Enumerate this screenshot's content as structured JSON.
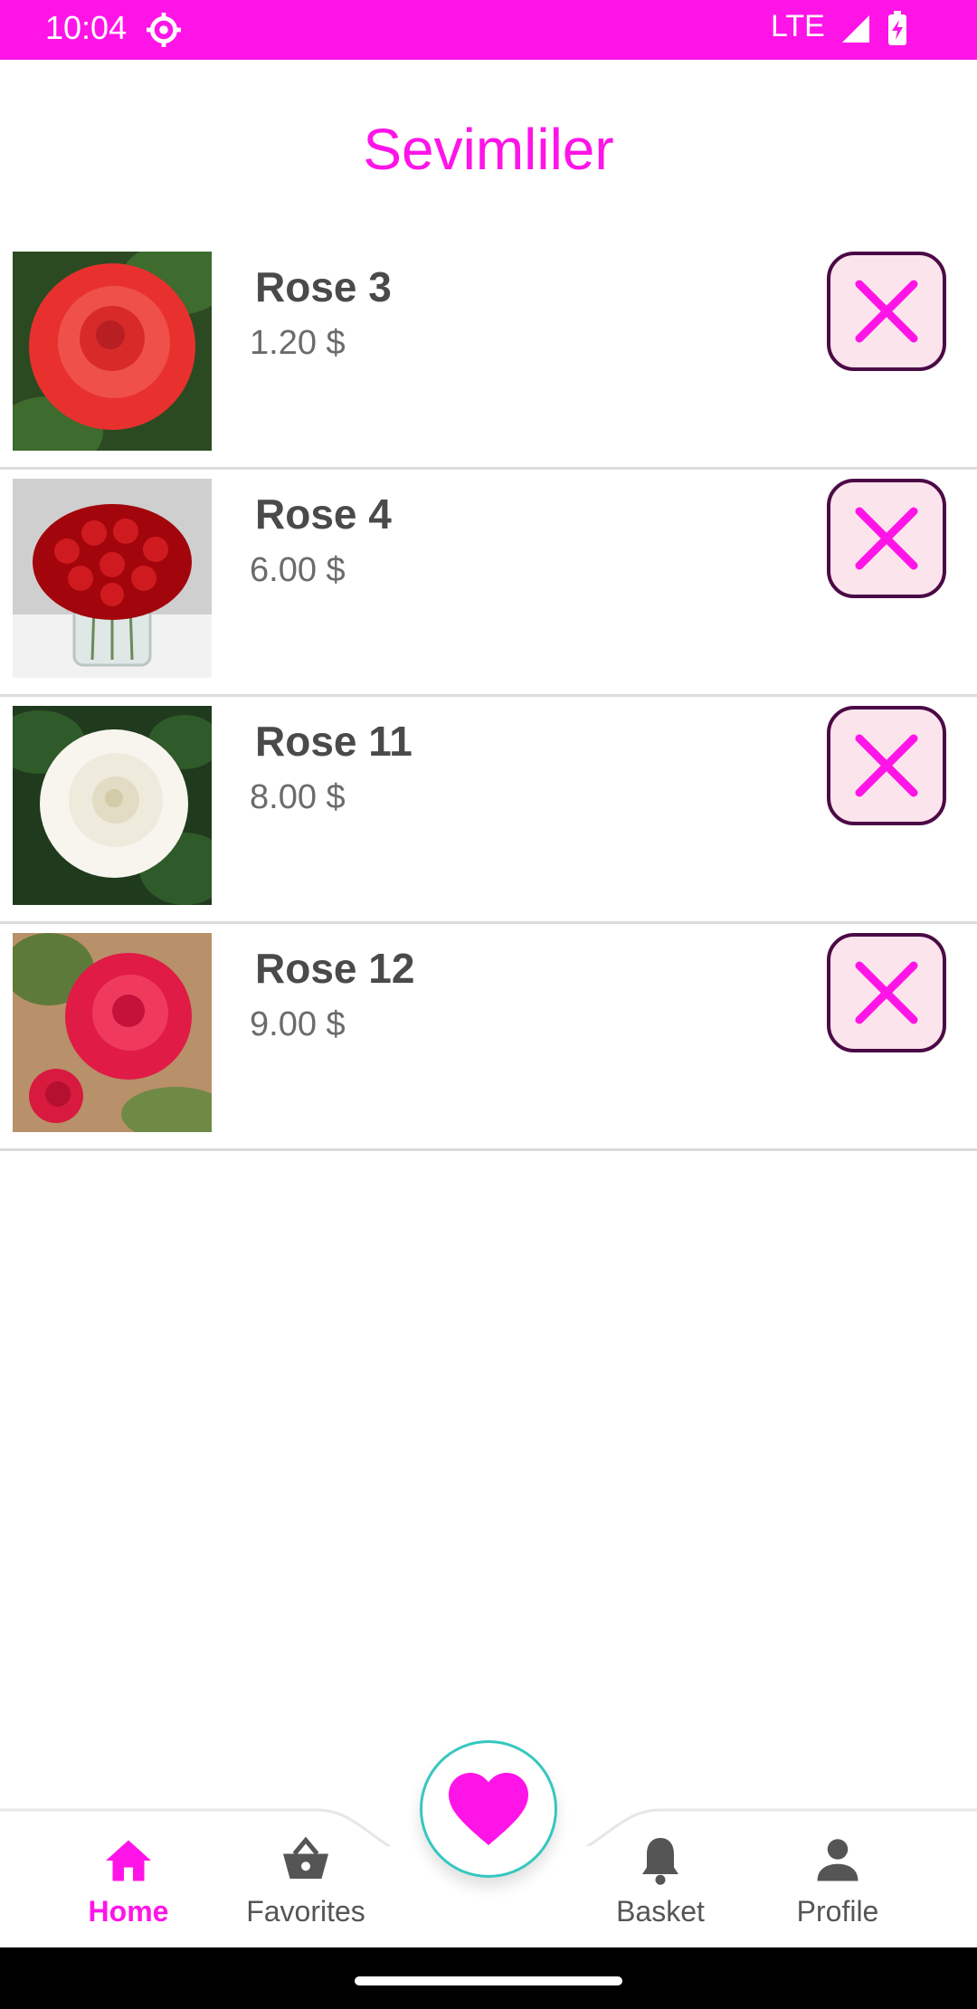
{
  "status_bar": {
    "time": "10:04",
    "network": "LTE"
  },
  "page": {
    "title": "Sevimliler"
  },
  "items": [
    {
      "name": "Rose 3",
      "price": "1.20 $"
    },
    {
      "name": "Rose 4",
      "price": "6.00 $"
    },
    {
      "name": "Rose 11",
      "price": "8.00 $"
    },
    {
      "name": "Rose 12",
      "price": "9.00 $"
    }
  ],
  "bottom_nav": {
    "items": [
      {
        "label": "Home",
        "icon": "home-icon",
        "active": true
      },
      {
        "label": "Favorites",
        "icon": "basket-icon"
      },
      {
        "label": "Basket",
        "icon": "bell-icon"
      },
      {
        "label": "Profile",
        "icon": "person-icon"
      }
    ],
    "fab_icon": "heart-icon"
  },
  "colors": {
    "accent": "#ff14e8",
    "remove_border": "#4b0a46",
    "remove_bg": "#fce4ec",
    "fab_border": "#35c7c0"
  }
}
